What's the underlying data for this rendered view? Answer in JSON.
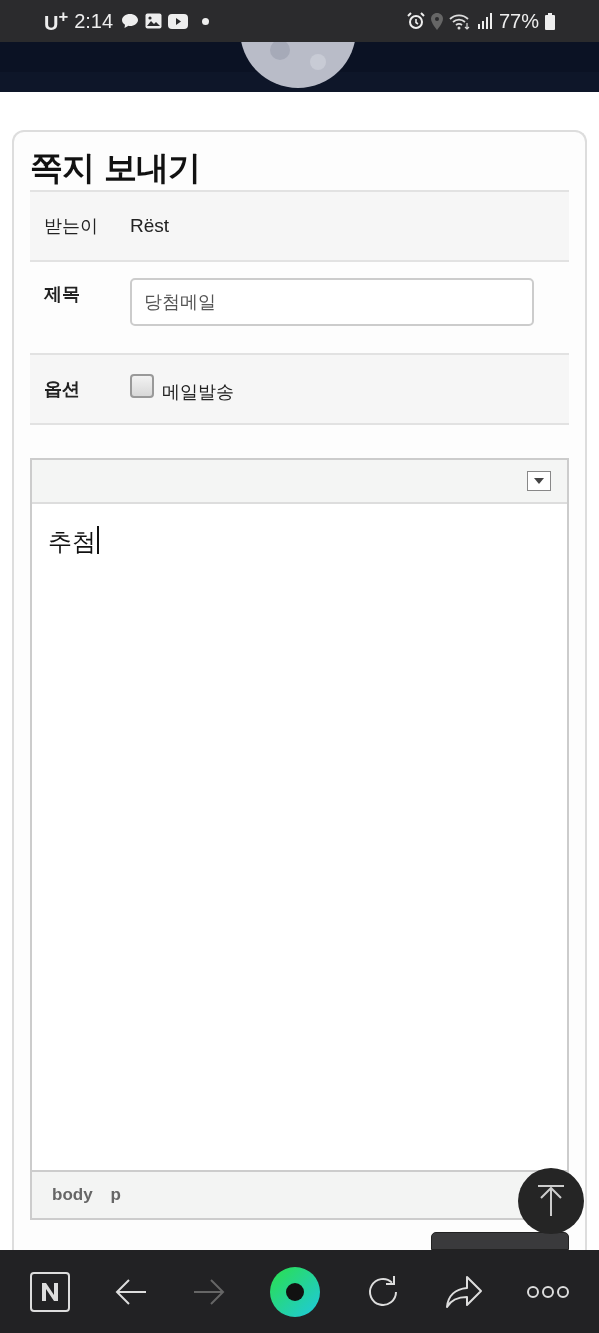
{
  "status_bar": {
    "carrier": "U$^{+}$",
    "time": "2:14",
    "battery": "77%"
  },
  "form": {
    "title": "쪽지 보내기",
    "recipient": {
      "label": "받는이",
      "value": "Rëst"
    },
    "subject": {
      "label": "제목",
      "value": "당첨메일"
    },
    "options": {
      "label": "옵션",
      "checkbox": {
        "label": "메일발송",
        "checked": false
      }
    }
  },
  "editor": {
    "content": "추첨",
    "path": [
      "body",
      "p"
    ]
  },
  "submit": {
    "kind": "button"
  }
}
